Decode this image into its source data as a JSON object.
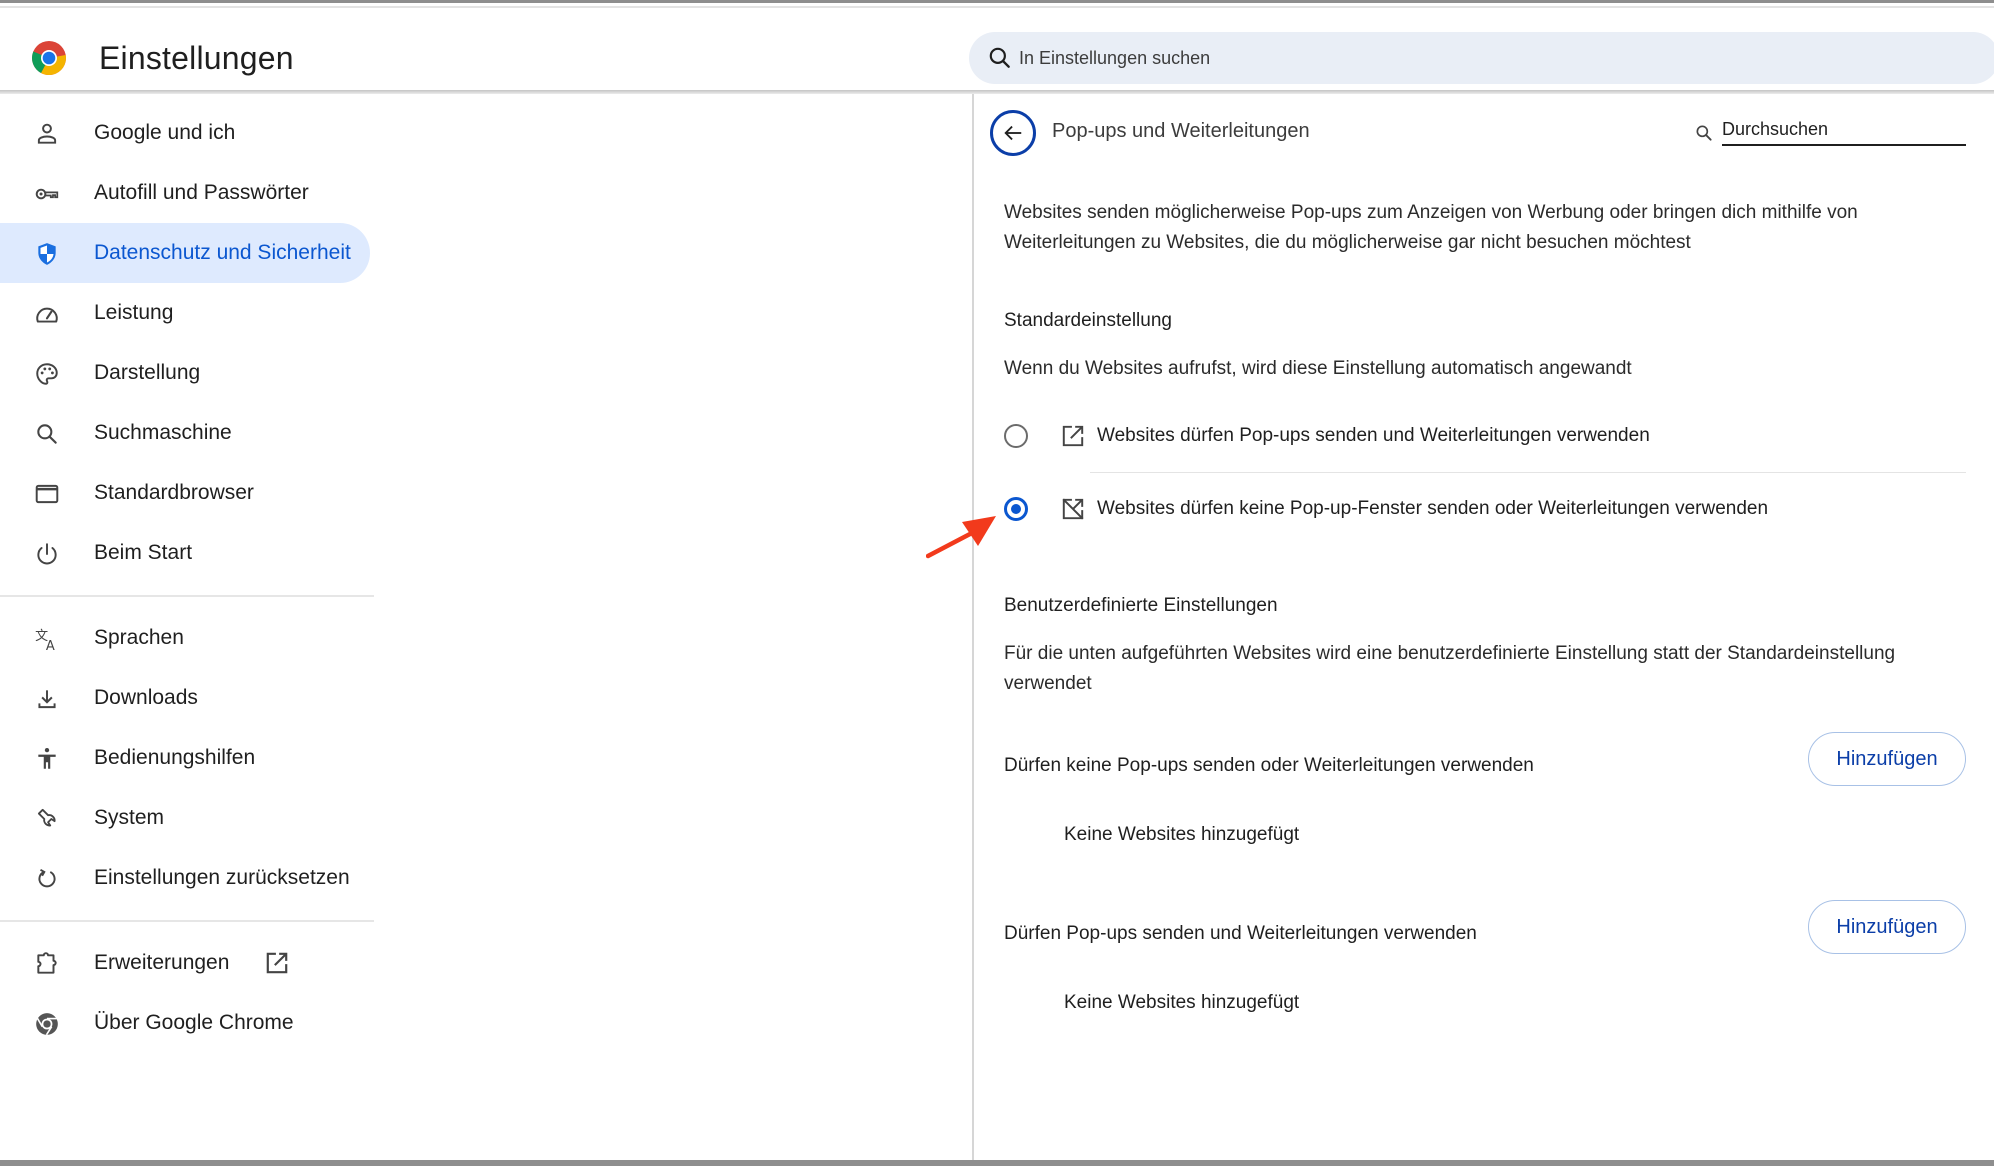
{
  "header": {
    "title": "Einstellungen",
    "search_placeholder": "In Einstellungen suchen"
  },
  "sidebar": {
    "items": [
      {
        "label": "Google und ich",
        "icon": "person-icon"
      },
      {
        "label": "Autofill und Passwörter",
        "icon": "key-icon"
      },
      {
        "label": "Datenschutz und Sicherheit",
        "icon": "shield-icon",
        "active": true
      },
      {
        "label": "Leistung",
        "icon": "speedometer-icon"
      },
      {
        "label": "Darstellung",
        "icon": "palette-icon"
      },
      {
        "label": "Suchmaschine",
        "icon": "search-icon"
      },
      {
        "label": "Standardbrowser",
        "icon": "browser-window-icon"
      },
      {
        "label": "Beim Start",
        "icon": "power-icon"
      },
      {
        "label": "Sprachen",
        "icon": "translate-icon"
      },
      {
        "label": "Downloads",
        "icon": "download-icon"
      },
      {
        "label": "Bedienungshilfen",
        "icon": "accessibility-icon"
      },
      {
        "label": "System",
        "icon": "wrench-icon"
      },
      {
        "label": "Einstellungen zurücksetzen",
        "icon": "reset-icon"
      },
      {
        "label": "Erweiterungen",
        "icon": "puzzle-icon",
        "external": true
      },
      {
        "label": "Über Google Chrome",
        "icon": "chrome-icon"
      }
    ]
  },
  "panel": {
    "title": "Pop-ups und Weiterleitungen",
    "search_placeholder": "Durchsuchen",
    "description": "Websites senden möglicherweise Pop-ups zum Anzeigen von Werbung oder bringen dich mithilfe von Weiterleitungen zu Websites, die du möglicherweise gar nicht besuchen möchtest",
    "default_section": {
      "heading": "Standardeinstellung",
      "subtitle": "Wenn du Websites aufrufst, wird diese Einstellung automatisch angewandt",
      "options": [
        {
          "label": "Websites dürfen Pop-ups senden und Weiterleitungen verwenden",
          "icon": "open-in-new-icon",
          "checked": false
        },
        {
          "label": "Websites dürfen keine Pop-up-Fenster senden oder Weiterleitungen verwenden",
          "icon": "popup-blocked-icon",
          "checked": true
        }
      ]
    },
    "custom_section": {
      "heading": "Benutzerdefinierte Einstellungen",
      "subtitle": "Für die unten aufgeführten Websites wird eine benutzerdefinierte Einstellung statt der Standardeinstellung verwendet",
      "lists": [
        {
          "label": "Dürfen keine Pop-ups senden oder Weiterleitungen verwenden",
          "button": "Hinzufügen",
          "empty": "Keine Websites hinzugefügt"
        },
        {
          "label": "Dürfen Pop-ups senden und Weiterleitungen verwenden",
          "button": "Hinzufügen",
          "empty": "Keine Websites hinzugefügt"
        }
      ]
    }
  },
  "colors": {
    "accent": "#0b57d0",
    "active_bg": "#d3e3fd",
    "search_bg": "#e9eef6",
    "annotation_arrow": "#f23a1c"
  }
}
